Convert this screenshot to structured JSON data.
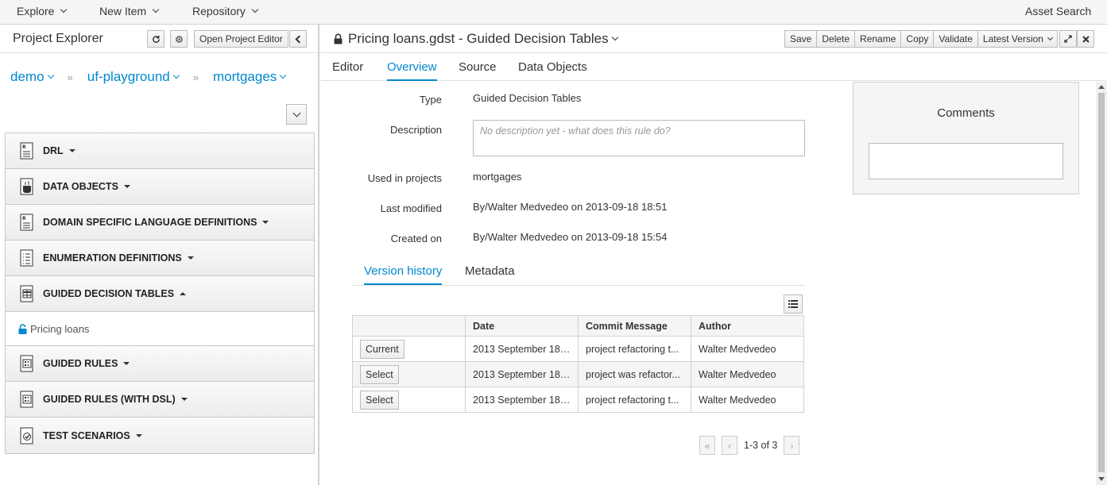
{
  "topnav": {
    "explore": "Explore",
    "new_item": "New Item",
    "repository": "Repository",
    "asset_search": "Asset Search"
  },
  "explorer": {
    "title": "Project Explorer",
    "open_editor_label": "Open Project Editor",
    "breadcrumbs": [
      "demo",
      "uf-playground",
      "mortgages"
    ],
    "categories": [
      {
        "label": "DRL",
        "icon": "rule-file-icon"
      },
      {
        "label": "DATA OBJECTS",
        "icon": "data-objects-icon"
      },
      {
        "label": "DOMAIN SPECIFIC LANGUAGE DEFINITIONS",
        "icon": "dsl-file-icon"
      },
      {
        "label": "ENUMERATION DEFINITIONS",
        "icon": "enumeration-icon"
      },
      {
        "label": "GUIDED DECISION TABLES",
        "icon": "decision-table-icon",
        "expanded": true
      },
      {
        "label": "GUIDED RULES",
        "icon": "guided-rule-icon"
      },
      {
        "label": "GUIDED RULES (WITH DSL)",
        "icon": "guided-rule-dsl-icon"
      },
      {
        "label": "TEST SCENARIOS",
        "icon": "test-scenario-icon"
      }
    ],
    "expanded_item": "Pricing loans"
  },
  "editor": {
    "title": "Pricing loans.gdst - Guided Decision Tables",
    "toolbar": [
      "Save",
      "Delete",
      "Rename",
      "Copy",
      "Validate",
      "Latest Version"
    ],
    "tabs": [
      "Editor",
      "Overview",
      "Source",
      "Data Objects"
    ],
    "active_tab": "Overview"
  },
  "overview": {
    "type_label": "Type",
    "type_value": "Guided Decision Tables",
    "description_label": "Description",
    "description_placeholder": "No description yet - what does this rule do?",
    "used_in_label": "Used in projects",
    "used_in_value": "mortgages",
    "last_modified_label": "Last modified",
    "last_modified_value": "By/Walter Medvedeo on 2013-09-18 18:51",
    "created_label": "Created on",
    "created_value": "By/Walter Medvedeo on 2013-09-18 15:54"
  },
  "history": {
    "tabs": [
      "Version history",
      "Metadata"
    ],
    "active_tab": "Version history",
    "columns": [
      "",
      "Date",
      "Commit Message",
      "Author"
    ],
    "rows": [
      {
        "button": "Current",
        "date": "2013 September 18,...",
        "message": "project refactoring t...",
        "author": "Walter Medvedeo"
      },
      {
        "button": "Select",
        "date": "2013 September 18,...",
        "message": "project was refactor...",
        "author": "Walter Medvedeo"
      },
      {
        "button": "Select",
        "date": "2013 September 18,...",
        "message": "project refactoring t...",
        "author": "Walter Medvedeo"
      }
    ],
    "pager_text": "1-3 of 3"
  },
  "comments": {
    "title": "Comments"
  }
}
